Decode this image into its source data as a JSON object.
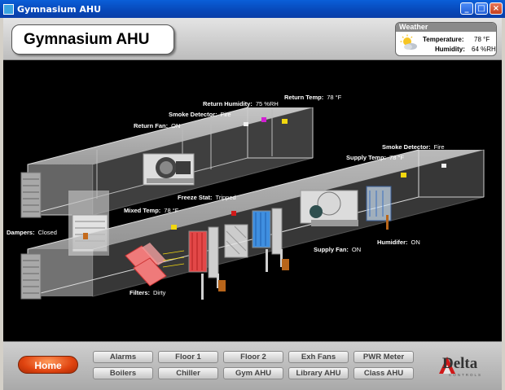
{
  "window": {
    "title": "Gymnasium AHU"
  },
  "header": {
    "title": "Gymnasium AHU"
  },
  "weather": {
    "heading": "Weather",
    "temperature_label": "Temperature:",
    "temperature_value": "78 °F",
    "humidity_label": "Humidity:",
    "humidity_value": "64 %RH",
    "icon": "partly-sunny-icon"
  },
  "points": {
    "return_humidity": {
      "label": "Return Humidity:",
      "value": "75 %RH"
    },
    "return_temp": {
      "label": "Return Temp:",
      "value": "78 °F"
    },
    "smoke_detector_return": {
      "label": "Smoke Detector:",
      "value": "Fire"
    },
    "return_fan": {
      "label": "Return Fan:",
      "value": "ON"
    },
    "smoke_detector_supply": {
      "label": "Smoke Detector:",
      "value": "Fire"
    },
    "supply_temp": {
      "label": "Supply Temp:",
      "value": "78 °F"
    },
    "freeze_stat": {
      "label": "Freeze Stat:",
      "value": "Tripped"
    },
    "mixed_temp": {
      "label": "Mixed Temp:",
      "value": "78 °F"
    },
    "dampers": {
      "label": "Dampers:",
      "value": "Closed"
    },
    "supply_fan": {
      "label": "Supply Fan:",
      "value": "ON"
    },
    "humidifier": {
      "label": "Humidifer:",
      "value": "ON"
    },
    "filters": {
      "label": "Filters:",
      "value": "Dirty"
    }
  },
  "nav": {
    "home": "Home",
    "row1": [
      "Alarms",
      "Floor 1",
      "Floor 2",
      "Exh Fans",
      "PWR Meter"
    ],
    "row2": [
      "Boilers",
      "Chiller",
      "Gym AHU",
      "Library AHU",
      "Class AHU"
    ]
  },
  "logo": {
    "text": "Delta",
    "subtext": "CONTROLS"
  },
  "colors": {
    "accent": "#e04410",
    "titlebar": "#0a5fd8",
    "canvas": "#000000",
    "alarm_red": "#d11a1a"
  }
}
